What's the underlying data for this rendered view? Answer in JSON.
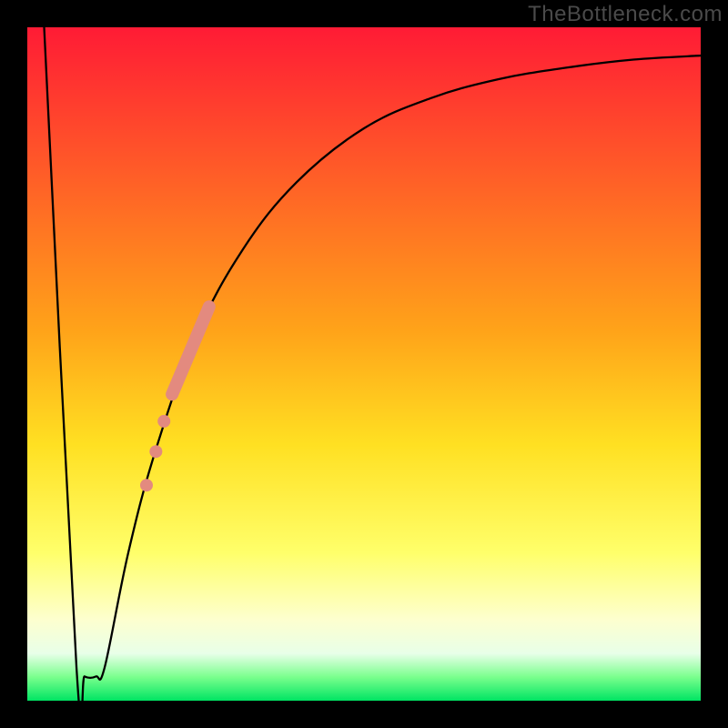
{
  "watermark": "TheBottleneck.com",
  "chart_data": {
    "type": "line",
    "title": "",
    "xlabel": "",
    "ylabel": "",
    "xlim": [
      0,
      100
    ],
    "ylim": [
      0,
      100
    ],
    "gradient_stops": [
      {
        "offset": 0.0,
        "color": "#ff1b35"
      },
      {
        "offset": 0.45,
        "color": "#ffa319"
      },
      {
        "offset": 0.62,
        "color": "#ffe022"
      },
      {
        "offset": 0.78,
        "color": "#ffff6a"
      },
      {
        "offset": 0.88,
        "color": "#fdffcf"
      },
      {
        "offset": 0.93,
        "color": "#e8ffe8"
      },
      {
        "offset": 0.965,
        "color": "#7aff8d"
      },
      {
        "offset": 1.0,
        "color": "#00e463"
      }
    ],
    "series": [
      {
        "name": "bottleneck-curve",
        "color": "#000000",
        "stroke_width": 2.3,
        "points": [
          {
            "x": 2.5,
            "y": 100
          },
          {
            "x": 7.3,
            "y": 5
          },
          {
            "x": 8.5,
            "y": 3.6
          },
          {
            "x": 10.2,
            "y": 3.6
          },
          {
            "x": 11.5,
            "y": 5
          },
          {
            "x": 15,
            "y": 22
          },
          {
            "x": 19,
            "y": 37
          },
          {
            "x": 25,
            "y": 54
          },
          {
            "x": 32,
            "y": 67
          },
          {
            "x": 40,
            "y": 77
          },
          {
            "x": 50,
            "y": 85
          },
          {
            "x": 60,
            "y": 89.5
          },
          {
            "x": 70,
            "y": 92.3
          },
          {
            "x": 80,
            "y": 94.0
          },
          {
            "x": 90,
            "y": 95.2
          },
          {
            "x": 100,
            "y": 95.8
          }
        ]
      }
    ],
    "highlight": {
      "name": "highlight-segment",
      "color": "#e38a7f",
      "thick_line": {
        "start": {
          "x": 21.5,
          "y": 45.5
        },
        "end": {
          "x": 27.0,
          "y": 58.5
        },
        "width": 14
      },
      "dots": [
        {
          "x": 20.3,
          "y": 41.5,
          "r": 7
        },
        {
          "x": 19.1,
          "y": 37.0,
          "r": 7
        },
        {
          "x": 17.7,
          "y": 32.0,
          "r": 7
        }
      ]
    }
  }
}
